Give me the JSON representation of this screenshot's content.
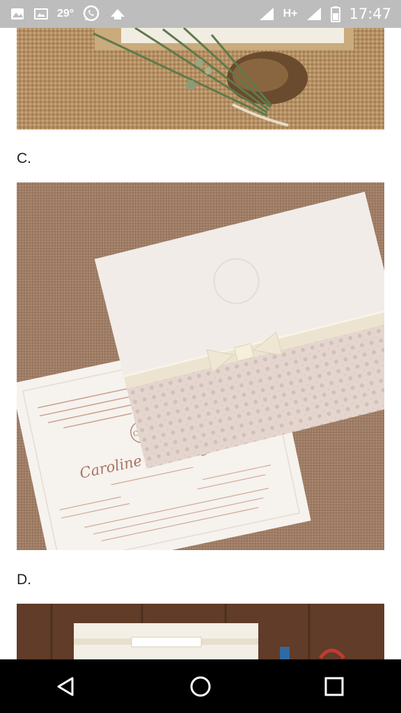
{
  "status_bar": {
    "temperature": "29°",
    "network": "H+",
    "time": "17:47",
    "icons": [
      "gallery-icon",
      "image-icon",
      "whatsapp-icon",
      "weather-icon",
      "signal-icon",
      "battery-icon"
    ]
  },
  "sections": [
    {
      "label": "C.",
      "image": "wedding-invitation-caroline-rodrigo"
    },
    {
      "label": "D.",
      "image": "wedding-invitation-rustic-wood"
    }
  ],
  "invitation_c": {
    "monogram": "C&R",
    "names": "Caroline e Rodrigo"
  },
  "nav_bar": {
    "buttons": [
      "back-icon",
      "home-icon",
      "recents-icon"
    ]
  },
  "colors": {
    "status_bar": "#bdbdbd",
    "nav_bar": "#000000",
    "burlap": "#b9966a",
    "envelope": "#f1ece8"
  }
}
